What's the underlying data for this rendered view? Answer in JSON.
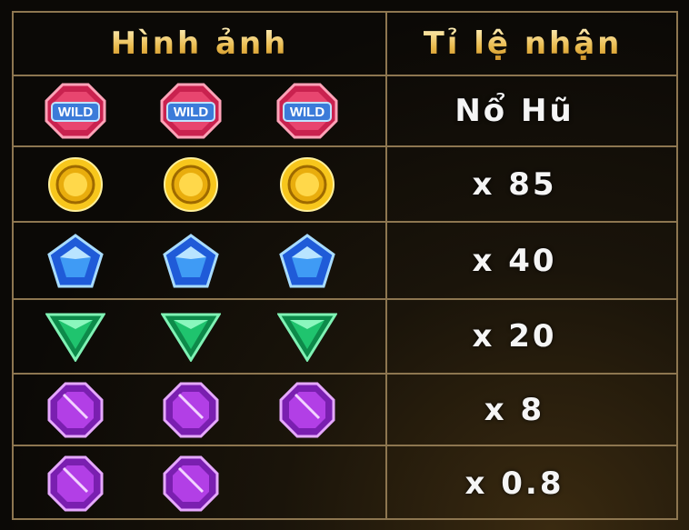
{
  "header": {
    "col_image": "Hình ảnh",
    "col_payout": "Tỉ lệ nhận"
  },
  "rows": [
    {
      "symbol": "wild-gem",
      "count": 3,
      "wild_text": "WILD",
      "payout": "Nổ Hũ"
    },
    {
      "symbol": "gold-coin",
      "count": 3,
      "payout": "x 85"
    },
    {
      "symbol": "blue-pentagon-gem",
      "count": 3,
      "payout": "x 40"
    },
    {
      "symbol": "green-triangle-gem",
      "count": 3,
      "payout": "x 20"
    },
    {
      "symbol": "purple-octagon-gem",
      "count": 3,
      "payout": "x 8"
    },
    {
      "symbol": "purple-octagon-gem",
      "count": 2,
      "payout": "x 0.8"
    }
  ],
  "colors": {
    "border": "#8d7650",
    "header_gold": "#e9b94a",
    "payout_text": "#f5f5f5"
  }
}
